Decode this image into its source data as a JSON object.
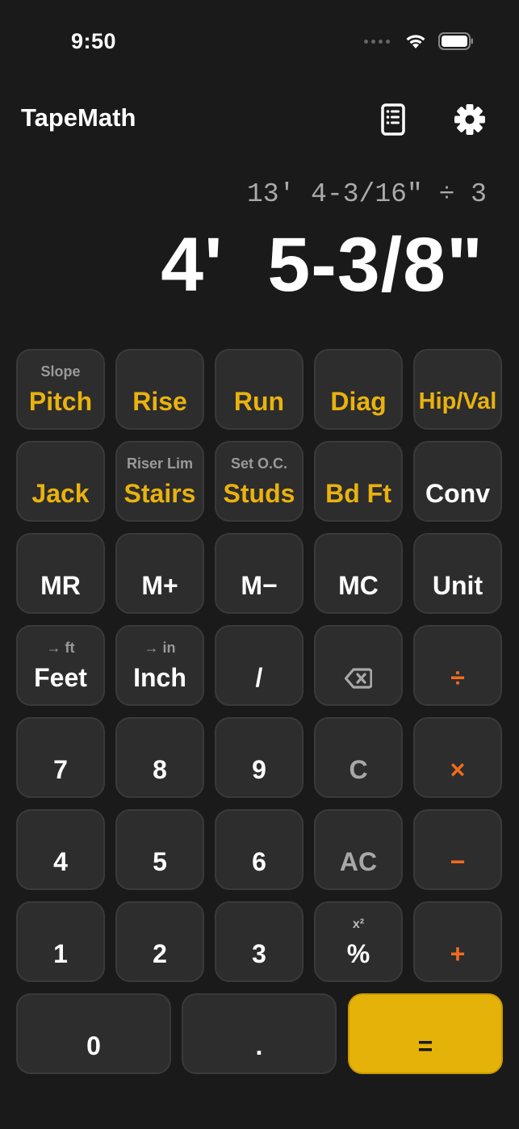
{
  "status_bar": {
    "time": "9:50"
  },
  "header": {
    "title": "TapeMath"
  },
  "display": {
    "expression": "13' 4-3/16\" ÷ 3",
    "result": "4'  5-3/8\""
  },
  "keys": {
    "pitch": {
      "sub": "Slope",
      "label": "Pitch"
    },
    "rise": {
      "label": "Rise"
    },
    "run": {
      "label": "Run"
    },
    "diag": {
      "label": "Diag"
    },
    "hipval": {
      "label": "Hip/Val"
    },
    "jack": {
      "label": "Jack"
    },
    "stairs": {
      "sub": "Riser Lim",
      "label": "Stairs"
    },
    "studs": {
      "sub": "Set O.C.",
      "label": "Studs"
    },
    "bdft": {
      "label": "Bd Ft"
    },
    "conv": {
      "label": "Conv"
    },
    "mr": {
      "label": "MR"
    },
    "mplus": {
      "label": "M+"
    },
    "mminus": {
      "label": "M−"
    },
    "mc": {
      "label": "MC"
    },
    "unit": {
      "label": "Unit"
    },
    "feet": {
      "sub": "→ ft",
      "label": "Feet"
    },
    "inch": {
      "sub": "→ in",
      "label": "Inch"
    },
    "fraction": {
      "label": "/"
    },
    "divide": {
      "label": "÷"
    },
    "seven": {
      "label": "7"
    },
    "eight": {
      "label": "8"
    },
    "nine": {
      "label": "9"
    },
    "clear": {
      "label": "C"
    },
    "multiply": {
      "label": "×"
    },
    "four": {
      "label": "4"
    },
    "five": {
      "label": "5"
    },
    "six": {
      "label": "6"
    },
    "all_clear": {
      "label": "AC"
    },
    "minus": {
      "label": "−"
    },
    "one": {
      "label": "1"
    },
    "two": {
      "label": "2"
    },
    "three": {
      "label": "3"
    },
    "percent": {
      "sub": "x²",
      "label": "%"
    },
    "plus": {
      "label": "+"
    },
    "zero": {
      "label": "0"
    },
    "decimal": {
      "label": "."
    },
    "equals": {
      "label": "="
    }
  },
  "icons": {
    "history": "document-list-icon",
    "settings": "gear-icon",
    "backspace": "backspace-icon"
  },
  "colors": {
    "background": "#1a1a1a",
    "key": "#2d2d2d",
    "accent_yellow": "#e9b20f",
    "operator_orange": "#f26b1d",
    "equals_key": "#e5b20a"
  }
}
